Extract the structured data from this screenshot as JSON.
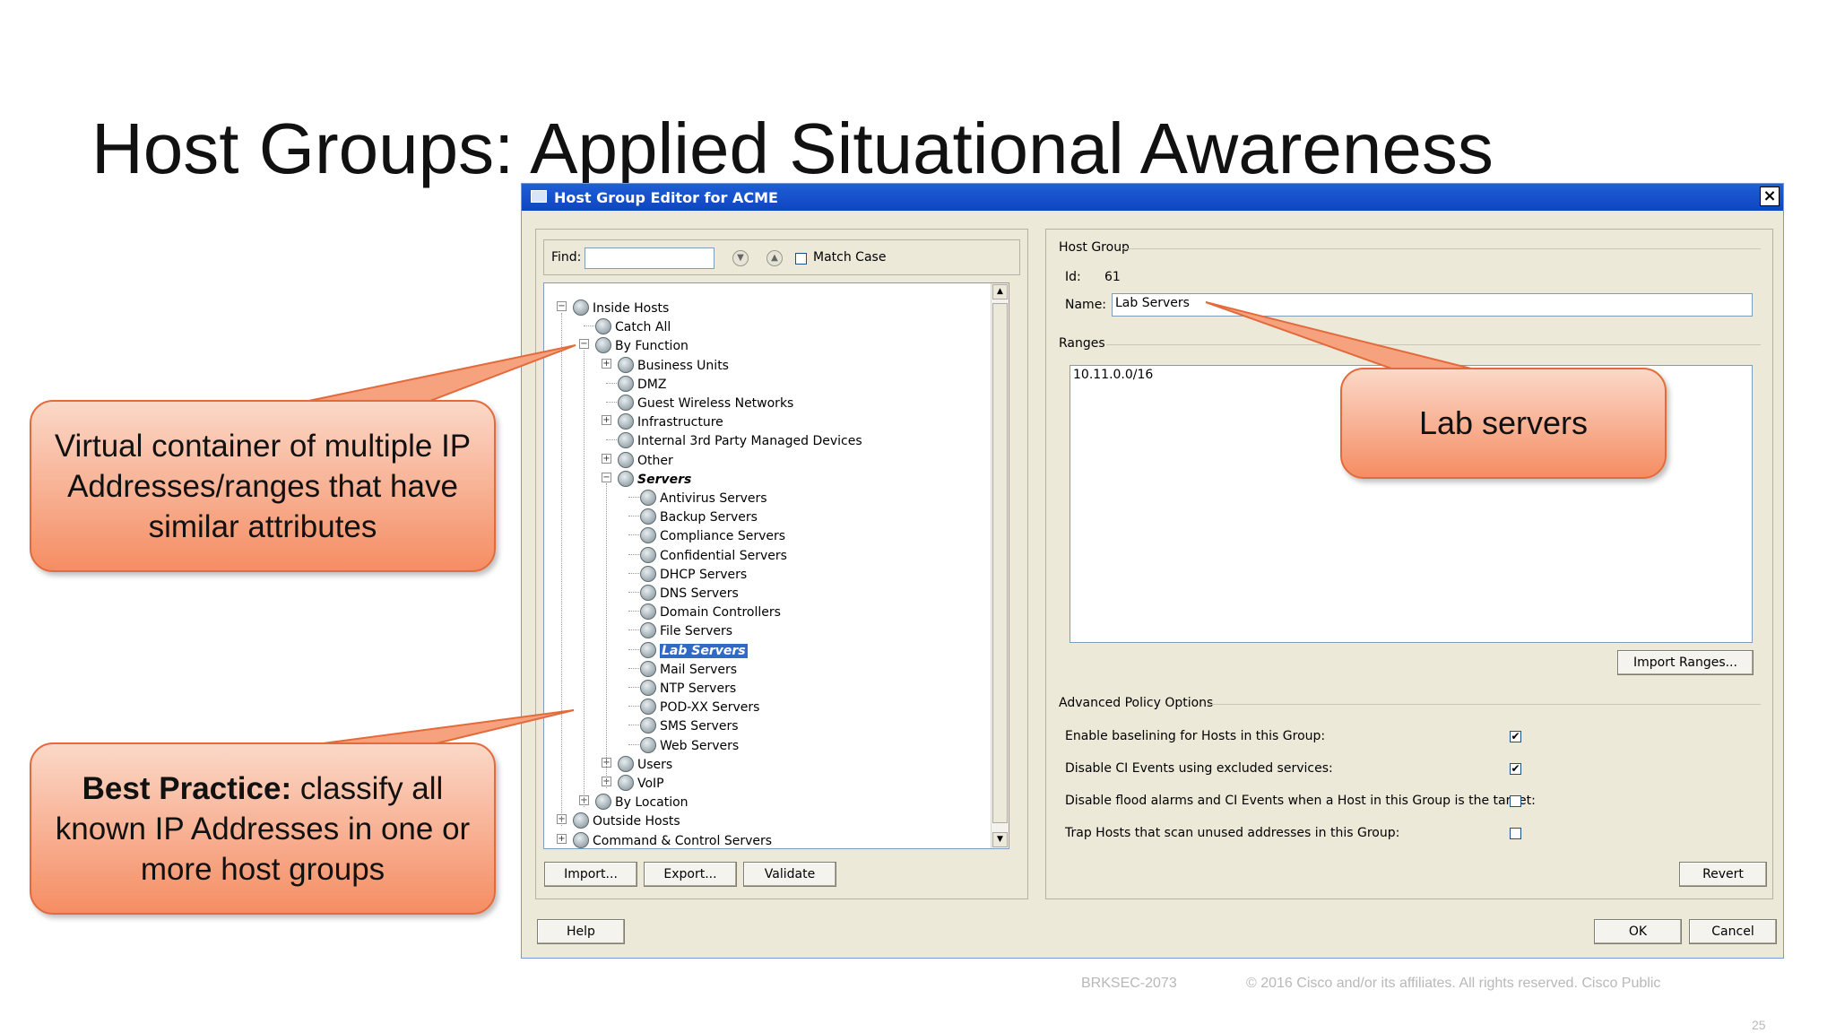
{
  "slide": {
    "title": "Host Groups: Applied Situational Awareness",
    "footer_left": "BRKSEC-2073",
    "footer_right": "© 2016  Cisco and/or its affiliates. All rights reserved.   Cisco Public",
    "page_number": "25"
  },
  "callouts": {
    "virtual_container": "Virtual container of multiple IP Addresses/ranges that have similar attributes",
    "best_practice_bold": "Best Practice:",
    "best_practice_rest": " classify all known IP Addresses in one or more host groups",
    "lab_servers": "Lab servers"
  },
  "dialog": {
    "title": "Host Group Editor for ACME",
    "close": "×",
    "find_label": "Find:",
    "find_value": "",
    "match_case_label": "Match Case",
    "tree": [
      {
        "label": "Inside Hosts",
        "level": 0,
        "toggle": "−"
      },
      {
        "label": "Catch All",
        "level": 1,
        "toggle": ""
      },
      {
        "label": "By Function",
        "level": 1,
        "toggle": "−"
      },
      {
        "label": "Business Units",
        "level": 2,
        "toggle": "+"
      },
      {
        "label": "DMZ",
        "level": 2,
        "toggle": ""
      },
      {
        "label": "Guest Wireless Networks",
        "level": 2,
        "toggle": ""
      },
      {
        "label": "Infrastructure",
        "level": 2,
        "toggle": "+"
      },
      {
        "label": "Internal 3rd Party Managed Devices",
        "level": 2,
        "toggle": ""
      },
      {
        "label": "Other",
        "level": 2,
        "toggle": "+"
      },
      {
        "label": "Servers",
        "level": 2,
        "toggle": "−",
        "style": "bold"
      },
      {
        "label": "Antivirus Servers",
        "level": 3,
        "toggle": ""
      },
      {
        "label": "Backup Servers",
        "level": 3,
        "toggle": ""
      },
      {
        "label": "Compliance Servers",
        "level": 3,
        "toggle": ""
      },
      {
        "label": "Confidential Servers",
        "level": 3,
        "toggle": ""
      },
      {
        "label": "DHCP Servers",
        "level": 3,
        "toggle": ""
      },
      {
        "label": "DNS Servers",
        "level": 3,
        "toggle": ""
      },
      {
        "label": "Domain Controllers",
        "level": 3,
        "toggle": ""
      },
      {
        "label": "File Servers",
        "level": 3,
        "toggle": ""
      },
      {
        "label": "Lab Servers",
        "level": 3,
        "toggle": "",
        "style": "selected"
      },
      {
        "label": "Mail Servers",
        "level": 3,
        "toggle": ""
      },
      {
        "label": "NTP Servers",
        "level": 3,
        "toggle": ""
      },
      {
        "label": "POD-XX Servers",
        "level": 3,
        "toggle": ""
      },
      {
        "label": "SMS Servers",
        "level": 3,
        "toggle": ""
      },
      {
        "label": "Web Servers",
        "level": 3,
        "toggle": ""
      },
      {
        "label": "Users",
        "level": 2,
        "toggle": "+"
      },
      {
        "label": "VoIP",
        "level": 2,
        "toggle": "+"
      },
      {
        "label": "By Location",
        "level": 1,
        "toggle": "+"
      },
      {
        "label": "Outside Hosts",
        "level": 0,
        "toggle": "+"
      },
      {
        "label": "Command & Control Servers",
        "level": 0,
        "toggle": "+"
      }
    ],
    "import_button": "Import...",
    "export_button": "Export...",
    "validate_button": "Validate",
    "host_group_section": "Host Group",
    "id_label": "Id:",
    "id_value": "61",
    "name_label": "Name:",
    "name_value": "Lab Servers",
    "ranges_section": "Ranges",
    "ranges_value": "10.11.0.0/16",
    "import_ranges_button": "Import Ranges...",
    "advanced_section": "Advanced Policy Options",
    "options": [
      {
        "label": "Enable baselining for Hosts in this Group:",
        "checked": true
      },
      {
        "label": "Disable CI Events using excluded services:",
        "checked": true
      },
      {
        "label": "Disable flood alarms and CI Events when a Host in this Group is the target:",
        "checked": false
      },
      {
        "label": "Trap Hosts that scan unused addresses in this Group:",
        "checked": false
      }
    ],
    "revert_button": "Revert",
    "help_button": "Help",
    "ok_button": "OK",
    "cancel_button": "Cancel"
  }
}
